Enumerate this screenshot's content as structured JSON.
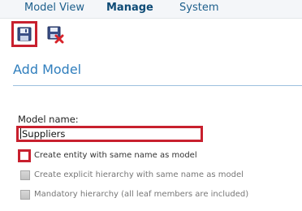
{
  "topnav": {
    "items": [
      {
        "label": "Model View",
        "active": false
      },
      {
        "label": "Manage",
        "active": true
      },
      {
        "label": "System",
        "active": false
      }
    ]
  },
  "toolbar": {
    "save_icon": "save-icon",
    "cancel_icon": "cancel-save-icon"
  },
  "section": {
    "title": "Add Model"
  },
  "form": {
    "model_name_label": "Model name:",
    "model_name_value": "Suppliers",
    "options": [
      {
        "label": "Create entity with same name as model",
        "checked": false,
        "enabled": true
      },
      {
        "label": "Create explicit hierarchy with same name as model",
        "checked": false,
        "enabled": false
      },
      {
        "label": "Mandatory hierarchy (all leaf members are included)",
        "checked": false,
        "enabled": false
      }
    ]
  },
  "colors": {
    "accent": "#2f7ebd",
    "nav_text": "#1d5f8c",
    "highlight": "#c8202e"
  }
}
